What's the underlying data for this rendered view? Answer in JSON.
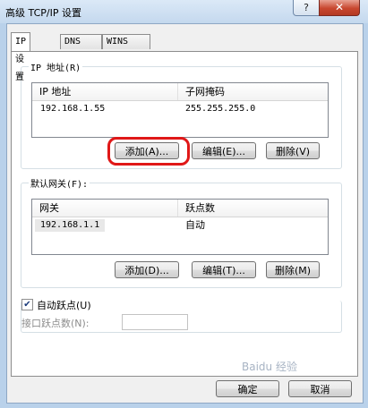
{
  "window": {
    "title": "高级 TCP/IP 设置",
    "help_glyph": "?",
    "close_glyph": "✕"
  },
  "tabs": [
    {
      "label": "IP 设置",
      "active": true
    },
    {
      "label": "DNS",
      "active": false
    },
    {
      "label": "WINS",
      "active": false
    }
  ],
  "ip_group": {
    "label": "IP 地址(R)",
    "columns": [
      "IP 地址",
      "子网掩码"
    ],
    "rows": [
      [
        "192.168.1.55",
        "255.255.255.0"
      ]
    ],
    "buttons": {
      "add": "添加(A)...",
      "edit": "编辑(E)...",
      "delete": "删除(V)"
    }
  },
  "gateway_group": {
    "label": "默认网关(F):",
    "columns": [
      "网关",
      "跃点数"
    ],
    "rows": [
      [
        "192.168.1.1",
        "自动"
      ]
    ],
    "buttons": {
      "add": "添加(D)...",
      "edit": "编辑(T)...",
      "delete": "删除(M)"
    }
  },
  "auto_metric": {
    "checked": true,
    "check_glyph": "✔",
    "label": "自动跃点(U)",
    "interface_metric_label": "接口跃点数(N):",
    "interface_metric_value": ""
  },
  "footer": {
    "ok": "确定",
    "cancel": "取消"
  },
  "watermark": "Baidu 经验"
}
